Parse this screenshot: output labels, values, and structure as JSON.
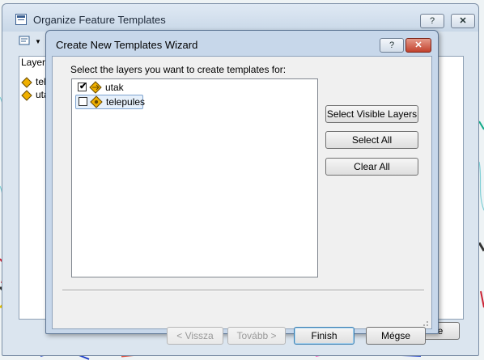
{
  "outer_window": {
    "title": "Organize Feature Templates",
    "help_label": "?",
    "close_label": "✕",
    "layers_header": "Layer",
    "layers": [
      "tele",
      "uta"
    ],
    "close_button_label": "Close"
  },
  "wizard": {
    "title": "Create New Templates Wizard",
    "help_label": "?",
    "close_label": "✕",
    "instruction": "Select the layers you want to create templates for:",
    "layers": [
      {
        "label": "utak",
        "checked": true
      },
      {
        "label": "telepules",
        "checked": false
      }
    ],
    "check_mark": "✔",
    "side_buttons": {
      "select_visible": "Select Visible Layers",
      "select_all": "Select All",
      "clear_all": "Clear All"
    },
    "footer_buttons": {
      "back": "< Vissza",
      "next": "Tovább >",
      "finish": "Finish",
      "cancel": "Mégse"
    }
  },
  "colors": {
    "accent": "#3c7fb1",
    "close_red": "#c2422e",
    "layer_icon": "#f0b000"
  }
}
